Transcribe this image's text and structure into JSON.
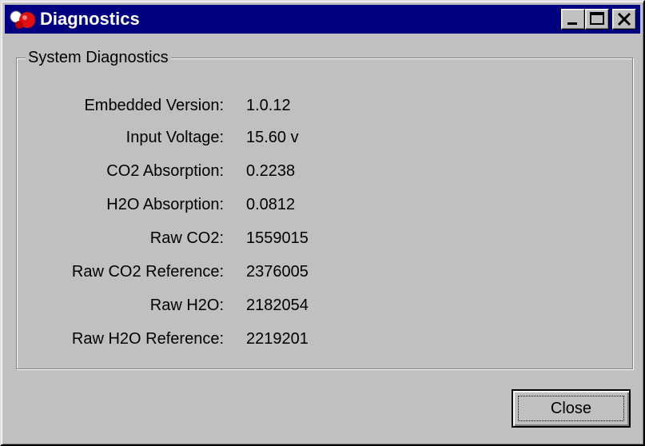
{
  "window": {
    "title": "Diagnostics",
    "app_icon": "app-logo-icon",
    "controls": [
      "minimize-icon",
      "maximize-icon",
      "close-icon"
    ]
  },
  "group": {
    "legend": "System Diagnostics"
  },
  "rows": [
    {
      "label": "Embedded Version:",
      "value": "1.0.12"
    },
    {
      "label": "Input Voltage:",
      "value": "15.60 v"
    },
    {
      "label": "CO2 Absorption:",
      "value": "0.2238"
    },
    {
      "label": "H2O Absorption:",
      "value": "0.0812"
    },
    {
      "label": "Raw CO2:",
      "value": "1559015"
    },
    {
      "label": "Raw CO2 Reference:",
      "value": "2376005"
    },
    {
      "label": "Raw H2O:",
      "value": "2182054"
    },
    {
      "label": "Raw H2O Reference:",
      "value": "2219201"
    }
  ],
  "buttons": {
    "close_label": "Close"
  },
  "colors": {
    "titlebar": "#000080",
    "face": "#c0c0c0"
  }
}
